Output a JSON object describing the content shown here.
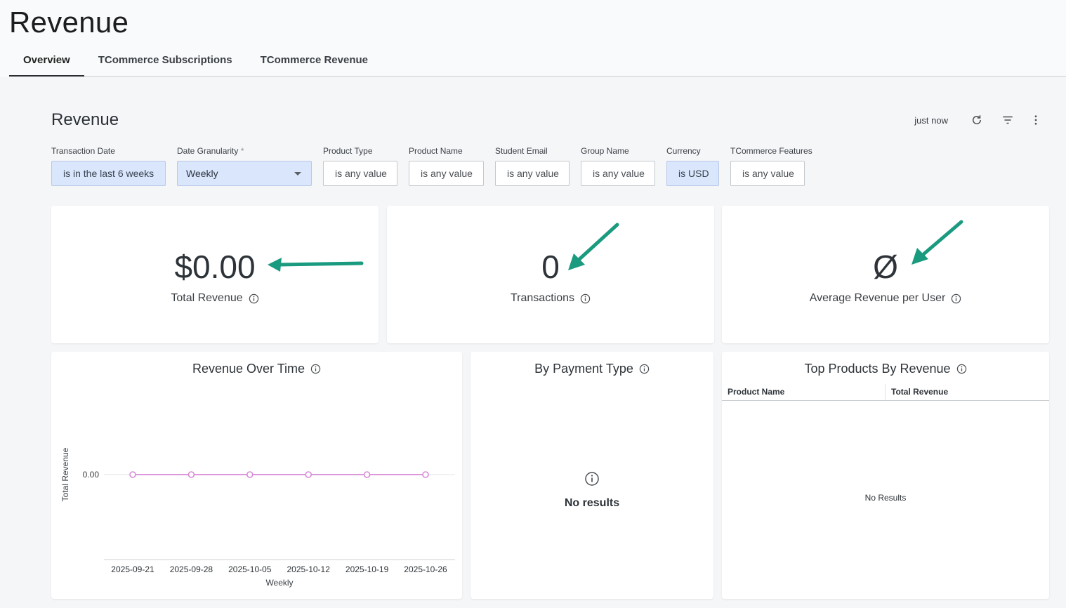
{
  "page": {
    "title": "Revenue",
    "tabs": [
      {
        "label": "Overview",
        "active": true
      },
      {
        "label": "TCommerce Subscriptions",
        "active": false
      },
      {
        "label": "TCommerce Revenue",
        "active": false
      }
    ]
  },
  "dashboard": {
    "title": "Revenue",
    "last_updated": "just now",
    "filters": [
      {
        "label": "Transaction Date",
        "value": "is in the last 6 weeks",
        "applied": true
      },
      {
        "label": "Date Granularity",
        "required_mark": "*",
        "value": "Weekly",
        "type": "select"
      },
      {
        "label": "Product Type",
        "value": "is any value"
      },
      {
        "label": "Product Name",
        "value": "is any value"
      },
      {
        "label": "Student Email",
        "value": "is any value"
      },
      {
        "label": "Group Name",
        "value": "is any value"
      },
      {
        "label": "Currency",
        "value": "is USD",
        "applied": true
      },
      {
        "label": "TCommerce Features",
        "value": "is any value"
      }
    ]
  },
  "kpis": {
    "total_revenue": {
      "value": "$0.00",
      "label": "Total Revenue"
    },
    "transactions": {
      "value": "0",
      "label": "Transactions"
    },
    "arpu": {
      "value": "Ø",
      "label": "Average Revenue per User"
    }
  },
  "tiles": {
    "revenue_over_time": {
      "title": "Revenue Over Time"
    },
    "by_payment_type": {
      "title": "By Payment Type",
      "empty_text": "No results"
    },
    "top_products": {
      "title": "Top Products By Revenue",
      "columns": [
        "Product Name",
        "Total Revenue"
      ],
      "empty_text": "No Results"
    }
  },
  "colors": {
    "accent_arrow": "#1a9a7e",
    "series_line": "#d88ad6",
    "filter_applied_bg": "#d9e6fb"
  },
  "chart_data": {
    "type": "line",
    "title": "Revenue Over Time",
    "xlabel": "Weekly",
    "ylabel": "Total Revenue",
    "categories": [
      "2025-09-21",
      "2025-09-28",
      "2025-10-05",
      "2025-10-12",
      "2025-10-19",
      "2025-10-26"
    ],
    "series": [
      {
        "values": [
          0,
          0,
          0,
          0,
          0,
          0
        ]
      }
    ],
    "y_ticks": [
      "0.00"
    ],
    "grid": true
  }
}
